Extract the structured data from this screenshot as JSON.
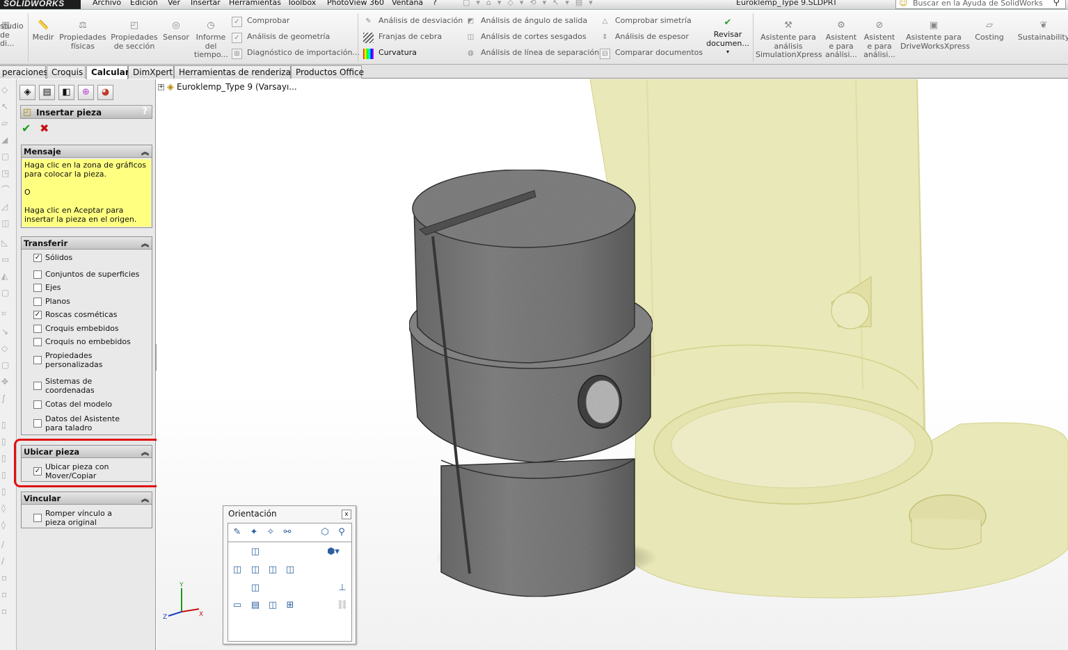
{
  "app": {
    "logo": "SOLIDWORKS",
    "menu": [
      "Archivo",
      "Edición",
      "Ver",
      "Insertar",
      "Herramientas",
      "Toolbox",
      "PhotoView 360",
      "Ventana",
      "?"
    ],
    "document_title": "Euroklemp_Type 9.SLDPRT",
    "help_search_placeholder": "Buscar en la Ayuda de SolidWorks"
  },
  "commands": {
    "left_partial": "studio de di...",
    "measure": "Medir",
    "mass_props": "Propiedades físicas",
    "section_props": "Propiedades de sección",
    "sensor": "Sensor",
    "statistics": "Informe del tiempo...",
    "check": "Comprobar",
    "geometry_analysis": "Análisis de geometría",
    "import_diagnostics": "Diagnóstico de importación...",
    "deviation_analysis": "Análisis de desviación",
    "zebra_stripes": "Franjas de cebra",
    "curvature": "Curvatura",
    "draft_analysis": "Análisis de ángulo de salida",
    "undercut_analysis": "Análisis de cortes sesgados",
    "parting_line_analysis": "Análisis de línea de separación",
    "symmetry_check": "Comprobar simetría",
    "thickness_analysis": "Análisis de espesor",
    "compare_documents": "Comparar documentos",
    "review_document": "Revisar documen...",
    "simulation_xpress": "Asistente para análisis SimulationXpress",
    "floxpress": "Asistent e para análisi...",
    "dfmxpress": "Asistent e para análisi...",
    "driveworks": "Asistente para DriveWorksXpress",
    "costing": "Costing",
    "sustainability": "Sustainability"
  },
  "tabs": [
    {
      "label": "peraciones",
      "active": false
    },
    {
      "label": "Croquis",
      "active": false
    },
    {
      "label": "Calcular",
      "active": true
    },
    {
      "label": "DimXpert",
      "active": false
    },
    {
      "label": "Herramientas de renderizado",
      "active": false
    },
    {
      "label": "Productos Office",
      "active": false
    }
  ],
  "property_manager": {
    "title": "Insertar pieza",
    "help": "?",
    "message": {
      "header": "Mensaje",
      "line1": "Haga clic en la zona de gráficos para colocar la pieza.",
      "line2": "O",
      "line3": "Haga clic en Aceptar para insertar la pieza en el origen."
    },
    "transfer": {
      "header": "Transferir",
      "items": [
        {
          "label": "Sólidos",
          "checked": true
        },
        {
          "label": "Conjuntos de superficies",
          "checked": false
        },
        {
          "label": "Ejes",
          "checked": false
        },
        {
          "label": "Planos",
          "checked": false
        },
        {
          "label": "Roscas cosméticas",
          "checked": true
        },
        {
          "label": "Croquis embebidos",
          "checked": false
        },
        {
          "label": "Croquis no embebidos",
          "checked": false
        },
        {
          "label": "Propiedades personalizadas",
          "checked": false
        },
        {
          "label": "Sistemas de coordenadas",
          "checked": false
        },
        {
          "label": "Cotas del modelo",
          "checked": false
        },
        {
          "label": "Datos del Asistente para taladro",
          "checked": false
        }
      ]
    },
    "locate": {
      "header": "Ubicar pieza",
      "item": {
        "label": "Ubicar pieza con Mover/Copiar",
        "checked": true
      }
    },
    "link": {
      "header": "Vincular",
      "item": {
        "label": "Romper vínculo a pieza original",
        "checked": false
      }
    }
  },
  "feature_tree": {
    "root": "Euroklemp_Type 9  (Varsayı..."
  },
  "orientation_dialog": {
    "title": "Orientación",
    "close": "x"
  },
  "triad": {
    "y": "Y",
    "z": "Z",
    "x": "X"
  },
  "colors": {
    "highlight": "#e01010",
    "message_bg": "#ffff80",
    "part_grey": "#7a7a7a",
    "ghost_part": "#e4e3a8"
  }
}
